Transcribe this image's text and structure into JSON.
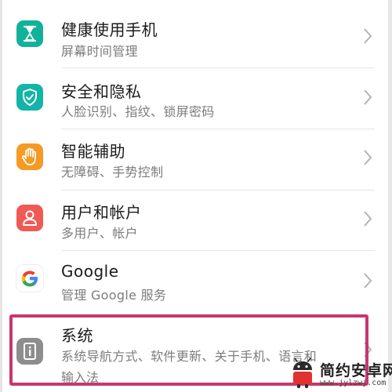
{
  "colors": {
    "health_tile": "#12b29a",
    "security_tile": "#12b5a8",
    "assist_tile": "#f59a24",
    "users_tile": "#ef5a55",
    "google_tile": "#ffffff",
    "system_tile": "#8d8d8d",
    "highlight": "#c8376f"
  },
  "items": [
    {
      "icon": "hourglass-icon",
      "title": "健康使用手机",
      "subtitle": "屏幕时间管理"
    },
    {
      "icon": "shield-check-icon",
      "title": "安全和隐私",
      "subtitle": "人脸识别、指纹、锁屏密码"
    },
    {
      "icon": "hand-icon",
      "title": "智能辅助",
      "subtitle": "无障碍、手势控制"
    },
    {
      "icon": "user-icon",
      "title": "用户和帐户",
      "subtitle": "多用户、帐户"
    },
    {
      "icon": "google-g-icon",
      "title": "Google",
      "subtitle": "管理 Google 服务"
    },
    {
      "icon": "system-info-icon",
      "title": "系统",
      "subtitle": "系统导航方式、软件更新、关于手机、语言和",
      "subtitle2": "输入法"
    }
  ],
  "watermark": {
    "text": "简约安卓网",
    "url": "www.jylzwj.com"
  }
}
